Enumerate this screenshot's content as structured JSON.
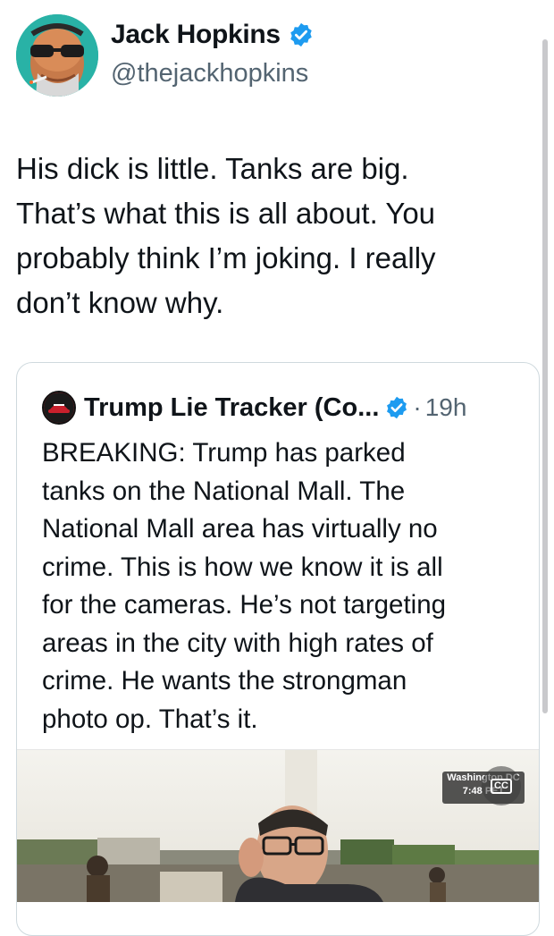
{
  "tweet": {
    "author_name": "Jack Hopkins",
    "author_handle": "@thejackhopkins",
    "text": "His dick is little. Tanks are big.\nThat’s what this is all about. You\nprobably think I’m joking. I really\ndon’t know why."
  },
  "quoted_tweet": {
    "author_name": "Trump Lie Tracker (Co...",
    "separator": "·",
    "time": "19h",
    "text": "BREAKING: Trump has parked\ntanks on the National Mall. The\nNational Mall area has virtually no\ncrime. This is how we know it is all\nfor the cameras. He’s not targeting\nareas in the city with high rates of\ncrime. He wants the strongman\nphoto op. That’s it.",
    "video": {
      "watermark_line1": "Washington DC",
      "watermark_line2": "7:48 PET",
      "cc_label": "CC"
    }
  },
  "icons": {
    "verified": "verified-badge-icon",
    "cc": "closed-captions-icon"
  },
  "colors": {
    "verified_blue": "#1d9bf0",
    "text": "#0f1419",
    "secondary_text": "#536471",
    "border": "#cfd9de"
  }
}
